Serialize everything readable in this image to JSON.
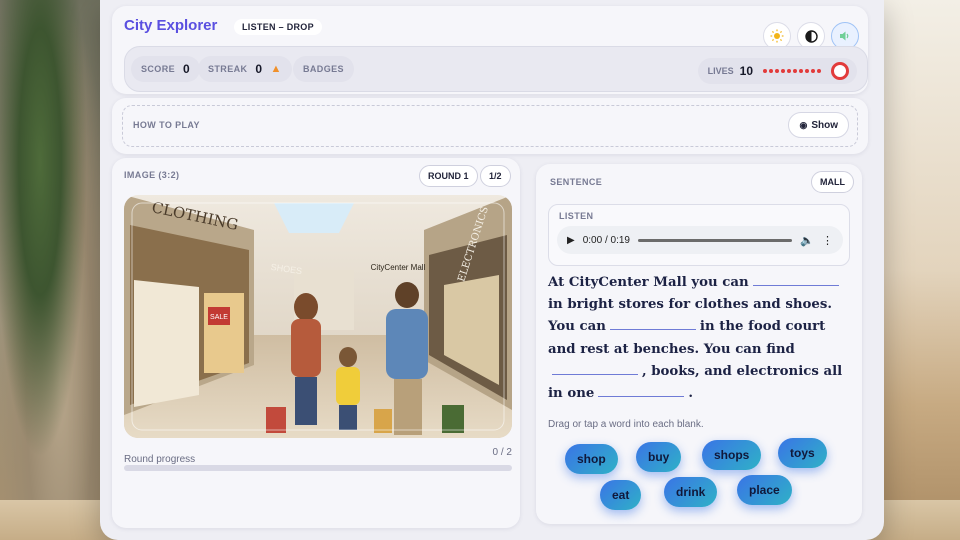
{
  "app": {
    "title": "City Explorer",
    "mode": "LISTEN – DROP"
  },
  "toolbar": {
    "theme_light_icon": "sun-icon",
    "contrast_icon": "contrast-icon",
    "sound_icon": "speaker-icon"
  },
  "stats": {
    "score_label": "SCORE",
    "score_value": "0",
    "streak_label": "STREAK",
    "streak_value": "0",
    "badges_label": "BADGES",
    "lives_label": "LIVES",
    "lives_value": "10",
    "lives_dots": 10
  },
  "howto": {
    "label": "HOW TO PLAY",
    "show_label": "Show"
  },
  "image_panel": {
    "label": "IMAGE (3:2)",
    "round_chip": "ROUND 1",
    "count_chip": "1/2",
    "progress_label": "Round progress",
    "progress_count": "0 / 2",
    "progress_fraction": 0,
    "scene_text": {
      "clothing": "CLOTHING",
      "shoes": "SHOES",
      "mall": "CityCenter Mall",
      "electronics": "ELECTRONICS",
      "sale": "SALE"
    }
  },
  "sentence_panel": {
    "label": "SENTENCE",
    "topic_chip": "MALL",
    "listen_label": "LISTEN",
    "player_time": "0:00 / 0:19",
    "segments": [
      "At CityCenter Mall you can",
      "in bright stores for clothes and shoes. You can",
      "in the food court and rest at benches. You can find",
      ", books, and electronics all in one",
      "."
    ],
    "hint": "Drag or tap a word into each blank.",
    "words": [
      "shop",
      "buy",
      "shops",
      "toys",
      "eat",
      "drink",
      "place"
    ]
  },
  "colors": {
    "accent": "#5a4fe0",
    "lives": "#e23b3b",
    "word_start": "#3a74e6",
    "word_end": "#2fb1c7"
  }
}
